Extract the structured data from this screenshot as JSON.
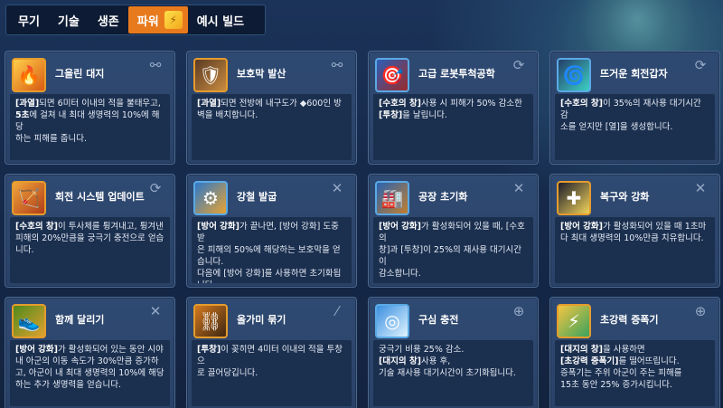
{
  "tabs": [
    {
      "label": "무기",
      "active": false
    },
    {
      "label": "기술",
      "active": false
    },
    {
      "label": "생존",
      "active": false
    },
    {
      "label": "파워",
      "active": true
    },
    {
      "label": "예시 빌드",
      "active": false
    }
  ],
  "power_tab_icon": "lightning-badge-icon",
  "cards": [
    {
      "name": "그을린 대지",
      "icon": "scorched-earth-icon",
      "corner": "chain-icon",
      "lines": [
        [
          "[과열]",
          "되면 6미터 이내의 적을 불태우고,"
        ],
        [
          "5초",
          "에 걸쳐 내 최대 생명력의 10%에 해당"
        ],
        [
          "",
          "하는 피해를 줍니다."
        ]
      ]
    },
    {
      "name": "보호막 발산",
      "icon": "shield-emit-icon",
      "corner": "chain-icon",
      "lines": [
        [
          "[과열]",
          "되면 전방에 내구도가 ◆600인 방"
        ],
        [
          "",
          "벽을 배치합니다."
        ]
      ]
    },
    {
      "name": "고급 로봇투척공학",
      "icon": "robot-throw-icon",
      "corner": "swirl-icon",
      "lines": [
        [
          "[수호의 창]",
          "사용 시 피해가 50% 감소한"
        ],
        [
          "[투창]",
          "을 날립니다."
        ]
      ]
    },
    {
      "name": "뜨거운 회전갑자",
      "icon": "hot-spin-icon",
      "corner": "swirl-icon",
      "lines": [
        [
          "[수호의 창]",
          "이 35%의 재사용 대기시간 감"
        ],
        [
          "",
          "소를 얻지만 [열]을 생성합니다."
        ]
      ]
    },
    {
      "name": "회전 시스템 업데이트",
      "icon": "spin-system-icon",
      "corner": "swirl-icon",
      "lines": [
        [
          "[수호의 창]",
          "이 투사체를 튕겨내고, 튕겨낸"
        ],
        [
          "",
          "피해의 20%만큼을 궁극기 충전으로 얻습"
        ],
        [
          "",
          "니다."
        ]
      ]
    },
    {
      "name": "강철 발굽",
      "icon": "steel-hoof-icon",
      "corner": "crossed-arrows-icon",
      "lines": [
        [
          "[방어 강화]",
          "가 끝나면, [방어 강화] 도중 받"
        ],
        [
          "",
          "은 피해의 50%에 해당하는 보호막을 얻"
        ],
        [
          "",
          "습니다."
        ],
        [
          "",
          "다음에 [방어 강화]를 사용하면 초기화됩"
        ],
        [
          "",
          "니다."
        ]
      ]
    },
    {
      "name": "공장 초기화",
      "icon": "factory-reset-icon",
      "corner": "crossed-arrows-icon",
      "lines": [
        [
          "[방어 강화]",
          "가 활성화되어 있을 때, [수호의"
        ],
        [
          "",
          "창]과 [투창]이 25%의 재사용 대기시간이"
        ],
        [
          "",
          "감소합니다."
        ]
      ]
    },
    {
      "name": "복구와 강화",
      "icon": "repair-fortify-icon",
      "corner": "crossed-arrows-icon",
      "lines": [
        [
          "[방어 강화]",
          "가 활성화되어 있을 때 1초마"
        ],
        [
          "",
          "다 최대 생명력의 10%만큼 치유합니다."
        ]
      ]
    },
    {
      "name": "함께 달리기",
      "icon": "run-together-icon",
      "corner": "crossed-arrows-icon",
      "lines": [
        [
          "[방어 강화]",
          "가 활성화되어 있는 동안 시야"
        ],
        [
          "",
          "내 아군의 이동 속도가 30%만큼 증가하"
        ],
        [
          "",
          "고, 아군이 내 최대 생명력의 10%에 해당"
        ],
        [
          "",
          "하는 추가 생명력을 얻습니다."
        ]
      ]
    },
    {
      "name": "올가미 묶기",
      "icon": "snare-tie-icon",
      "corner": "spear-icon",
      "lines": [
        [
          "[투창]",
          "이 꽂히면 4미터 이내의 적을 투창으"
        ],
        [
          "",
          "로 끌어당깁니다."
        ]
      ]
    },
    {
      "name": "구심 충전",
      "icon": "centripetal-charge-icon",
      "corner": "target-icon",
      "lines": [
        [
          "",
          "궁극기 비용 25% 감소."
        ],
        [
          "[대지의 창]",
          "사용 후,"
        ],
        [
          "",
          "기술 재사용 대기시간이 초기화됩니다."
        ]
      ]
    },
    {
      "name": "초강력 증폭기",
      "icon": "super-amplifier-icon",
      "corner": "target-icon",
      "lines": [
        [
          "[대지의 창]",
          "을 사용하면"
        ],
        [
          "[초강력 증폭기]",
          "를 떨어뜨립니다."
        ],
        [
          "",
          "증폭기는 주위 아군이 주는 피해를"
        ],
        [
          "",
          "15초 동안 25% 증가시킵니다."
        ]
      ]
    }
  ]
}
